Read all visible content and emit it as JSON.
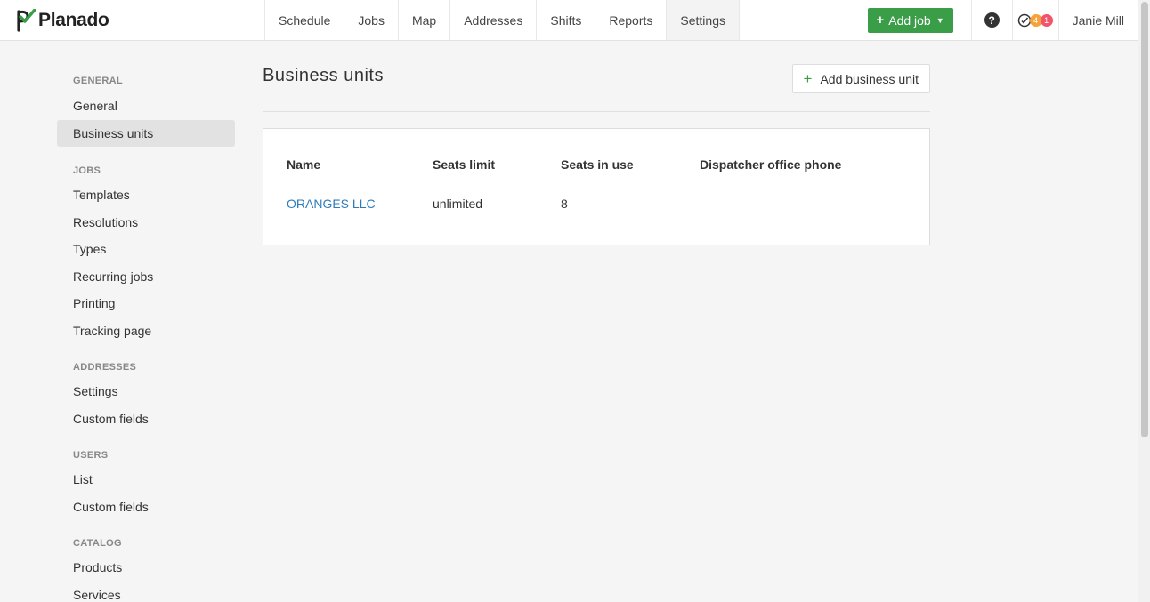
{
  "app": {
    "logo_text": "Planado",
    "logo_color": "#3a9d48"
  },
  "nav": {
    "items": [
      {
        "label": "Schedule"
      },
      {
        "label": "Jobs"
      },
      {
        "label": "Map"
      },
      {
        "label": "Addresses"
      },
      {
        "label": "Shifts"
      },
      {
        "label": "Reports"
      },
      {
        "label": "Settings",
        "active": true
      }
    ],
    "add_job_label": "Add job",
    "help_symbol": "?",
    "notifications": {
      "orange_count": "4",
      "red_count": "1"
    },
    "user_name": "Janie Mill"
  },
  "sidebar": {
    "sections": [
      {
        "heading": "GENERAL",
        "items": [
          "General",
          "Business units"
        ]
      },
      {
        "heading": "JOBS",
        "items": [
          "Templates",
          "Resolutions",
          "Types",
          "Recurring jobs",
          "Printing",
          "Tracking page"
        ]
      },
      {
        "heading": "ADDRESSES",
        "items": [
          "Settings",
          "Custom fields"
        ]
      },
      {
        "heading": "USERS",
        "items": [
          "List",
          "Custom fields"
        ]
      },
      {
        "heading": "CATALOG",
        "items": [
          "Products",
          "Services"
        ]
      }
    ],
    "active_item": "Business units"
  },
  "main": {
    "title": "Business units",
    "add_button_label": "Add business unit",
    "table": {
      "headers": [
        "Name",
        "Seats limit",
        "Seats in use",
        "Dispatcher office phone"
      ],
      "rows": [
        [
          "ORANGES LLC",
          "unlimited",
          "8",
          "–"
        ]
      ]
    }
  }
}
